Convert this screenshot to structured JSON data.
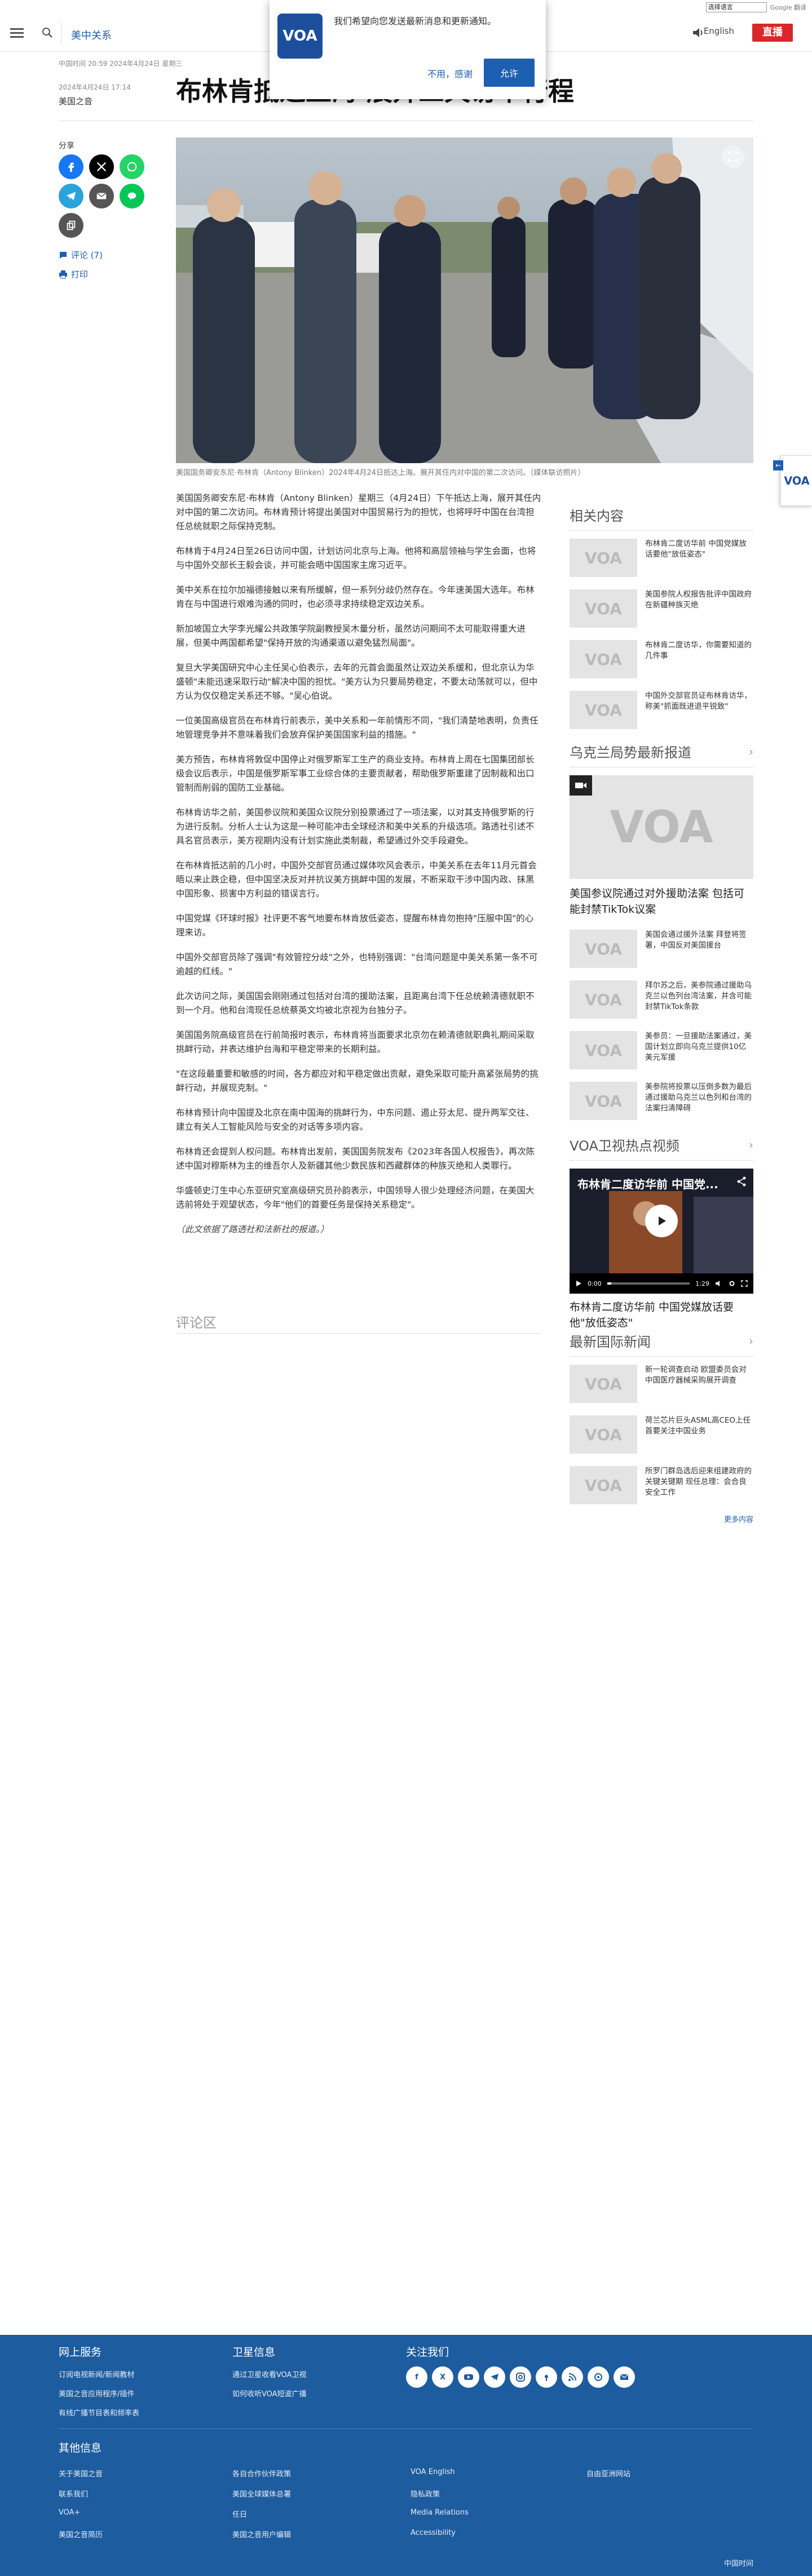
{
  "translate": {
    "select_label": "选择语言",
    "powered_by": "Google 翻译"
  },
  "header": {
    "section": "美中关系",
    "language": "English",
    "live_label": "直播"
  },
  "notification": {
    "message": "我们希望向您发送最新消息和更新通知。",
    "cancel_label": "不用，感谢",
    "allow_label": "允许",
    "logo_text": "VOA"
  },
  "article": {
    "date_line": "中国时间 20:59 2024年4月24日 星期三",
    "byline_date": "2024年4月24日 17:14",
    "author": "美国之音",
    "title": "布林肯抵达上海 展开三天访华行程",
    "share_label": "分享",
    "comments_label": "评论 (7)",
    "print_label": "打印",
    "caption": "美国国务卿安东尼·布林肯（Antony Blinken）2024年4月24日抵达上海。展开其任内对中国的第二次访问。（媒体联访照片）",
    "paragraphs": [
      "美国国务卿安东尼·布林肯（Antony Blinken）星期三（4月24日）下午抵达上海，展开其任内对中国的第二次访问。布林肯预计将提出美国对中国贸易行为的担忧，也将呼吁中国在台湾担任总统就职之际保持克制。",
      "布林肯于4月24日至26日访问中国，计划访问北京与上海。他将和高层领袖与学生会面，也将与中国外交部长王毅会谈，并可能会晤中国国家主席习近平。",
      "美中关系在拉尔加福德接触以来有所缓解，但一系列分歧仍然存在。今年速美国大选年。布林肯在与中国进行艰难沟通的同时，也必须寻求持续稳定双边关系。",
      "新加坡国立大学李光耀公共政策学院副教授吴木量分析，虽然访问期间不太可能取得重大进展，但美中两国都希望\"保持开放的沟通渠道以避免猛烈局面\"。",
      "复旦大学美国研究中心主任吴心伯表示，去年的元首会面虽然让双边关系缓和，但北京认为华盛顿\"未能迅速采取行动\"解决中国的担忧。\"美方认为只要局势稳定，不要太动荡就可以，但中方认为仅仅稳定关系还不够。\"吴心伯说。",
      "一位美国高级官员在布林肯行前表示，美中关系和一年前情形不同，\"我们清楚地表明，负责任地管理竞争并不意味着我们会放弃保护美国国家利益的措施。\"",
      "美方预告，布林肯将敦促中国停止对俄罗斯军工生产的商业支持。布林肯上周在七国集团部长级会议后表示，中国是俄罗斯军事工业综合体的主要贡献者，帮助俄罗斯重建了因制裁和出口管制而削弱的国防工业基础。",
      "布林肯访华之前，美国参议院和美国众议院分别投票通过了一项法案，以对其支持俄罗斯的行为进行反制。分析人士认为这是一种可能冲击全球经济和美中关系的升级选项。路透社引述不具名官员表示，美方视期内没有计划实施此类制裁，希望通过外交手段避免。",
      "在布林肯抵达前的几小时，中国外交部官员通过媒体吹风会表示，中美关系在去年11月元首会晤以来止跌企稳，但中国坚决反对并抗议美方挑衅中国的发展，不断采取干涉中国内政、抹黑中国形象、损害中方利益的错误言行。",
      "中国党媒《环球时报》社评更不客气地要布林肯放低姿态，提醒布林肯勿抱持\"压服中国\"的心理来访。",
      "中国外交部官员除了强调\"有效管控分歧\"之外，也特别强调：\"台湾问题是中美关系第一条不可逾越的红线。\"",
      "此次访问之际，美国国会刚刚通过包括对台湾的援助法案，且距离台湾下任总统赖清德就职不到一个月。他和台湾现任总统蔡英文均被北京视为台独分子。",
      "美国国务院高级官员在行前简报时表示，布林肯将当面要求北京勿在赖清德就职典礼期间采取挑衅行动，并表达维护台海和平稳定带来的长期利益。",
      "\"在这段最重要和敏感的时间，各方都应对和平稳定做出贡献，避免采取可能升高紧张局势的挑衅行动，并展现克制。\"",
      "布林肯预计向中国提及北京在南中国海的挑衅行为，中东问题、遏止芬太尼、提升两军交往、建立有关人工智能风险与安全的对话等多项内容。",
      "布林肯还会提到人权问题。布林肯出发前，美国国务院发布《2023年各国人权报告》，再次陈述中国对穆斯林为主的维吾尔人及新疆其他少数民族和西藏群体的种族灭绝和人类罪行。",
      "华盛顿史汀生中心东亚研究室高级研究员孙韵表示，中国领导人很少处理经济问题，在美国大选前将处于观望状态，今年\"他们的首要任务是保持关系稳定\"。",
      "（此文依据了路透社和法新社的报道。）"
    ],
    "comments_heading": "评论区"
  },
  "rail": {
    "related_title": "相关内容",
    "related": [
      "布林肯二度访华前 中国党媒放话要他\"放低姿态\"",
      "美国参院人权报告批评中国政府在新疆种族灭绝",
      "布林肯二度访华，你需要知道的几件事",
      "中国外交部官员证布林肯访华，称美\"抓面既进退平锐致\""
    ],
    "ukraine_title": "乌克兰局势最新报道",
    "ukraine_feature": "美国参议院通过对外援助法案 包括可能封禁TikTok议案",
    "ukraine_items": [
      "美国会通过援外法案 拜登将签署，中国反对美国援台",
      "拜尔苏之后，美参院通过援助乌克兰以色列台湾法案，并含可能封禁TikTok条款",
      "美参员：一旦援助法案通过，美国计划立即向乌克兰提供10亿美元军援",
      "美参院将投票以压倒多数为最后通过援助乌克兰以色列和台湾的法案扫清障碍"
    ],
    "video_title": "VOA卫视热点视频",
    "video_overlay": "布林肯二度访华前 中国党...",
    "video_time_current": "0:00",
    "video_time_total": "1:29",
    "video_progress": 0.05,
    "video_caption": "布林肯二度访华前 中国党媒放话要他\"放低姿态\"",
    "intl_title": "最新国际新闻",
    "intl_items": [
      "新一轮调查启动 欧盟委员会对中国医疗器械采购展开调查",
      "荷兰芯片巨头ASML高CEO上任首要关注中国业务",
      "所罗门群岛选后迎来组建政府的关键关键期 现任总理：会合良安全工作"
    ],
    "more_label": "更多内容"
  },
  "footer": {
    "col1_title": "网上服务",
    "col1_links": [
      "订阅电视新闻/新闻教材",
      "美国之音应用程序/插件",
      "有线广播节目表和频率表"
    ],
    "col2_title": "卫星信息",
    "col2_links": [
      "通过卫星收看VOA卫视",
      "如何收听VOA短波广播"
    ],
    "col3_title": "关注我们",
    "social": [
      "facebook-icon",
      "x-icon",
      "youtube-icon",
      "telegram-icon",
      "instagram-icon",
      "podcast-icon",
      "rss-icon",
      "podcast2-icon",
      "email-icon"
    ],
    "other_title": "其他信息",
    "other_links": [
      [
        "关于美国之音",
        "各自合作伙伴政策",
        "VOA English",
        "自由亚洲网站"
      ],
      [
        "联系我们",
        "美国全球媒体总署",
        "隐私政策",
        ""
      ],
      [
        "VOA+",
        "任日",
        "Media Relations",
        ""
      ],
      [
        "美国之音简历",
        "美国之音用户编辑",
        "Accessibility",
        ""
      ]
    ],
    "copyright": "中国时间"
  },
  "brand": {
    "primary": "#1d5fb0",
    "live": "#d8282b",
    "footer": "#1d5c9e"
  }
}
